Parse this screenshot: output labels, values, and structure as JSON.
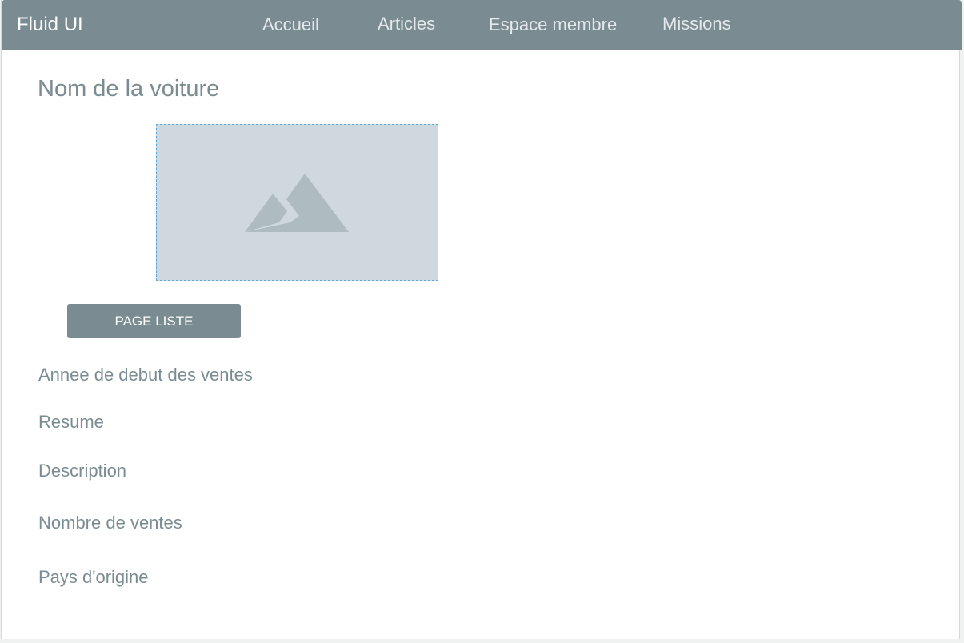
{
  "navbar": {
    "brand": "Fluid UI",
    "links": [
      "Accueil",
      "Articles",
      "Espace membre",
      "Missions"
    ]
  },
  "main": {
    "title": "Nom de la voiture",
    "image_icon": "image-placeholder-icon",
    "button_label": "PAGE LISTE",
    "fields": [
      "Annee de debut des ventes",
      "Resume",
      "Description",
      "Nombre de ventes",
      "Pays d'origine"
    ]
  },
  "colors": {
    "navbar": "#7a8b91",
    "text": "#7a8b91",
    "placeholder_bg": "#cfd8de",
    "placeholder_icon": "#aebbc1",
    "selection_border": "#5aa7d8"
  }
}
